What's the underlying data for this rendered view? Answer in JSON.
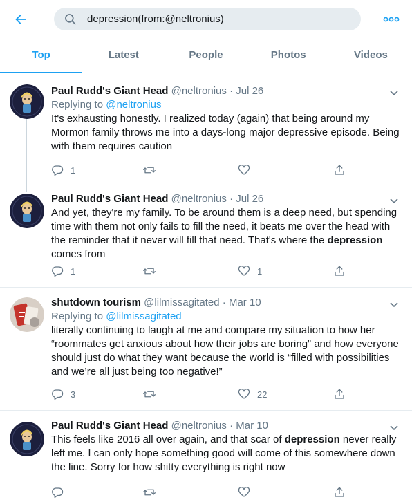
{
  "search": {
    "query": "depression(from:@neltronius)"
  },
  "tabs": [
    {
      "label": "Top"
    },
    {
      "label": "Latest"
    },
    {
      "label": "People"
    },
    {
      "label": "Photos"
    },
    {
      "label": "Videos"
    }
  ],
  "colors": {
    "accent": "#1da1f2",
    "muted": "#657786",
    "text": "#14171a",
    "divider": "#e6ecf0"
  },
  "tweets": [
    {
      "name": "Paul Rudd's Giant Head",
      "handle": "@neltronius",
      "dot": "·",
      "date": "Jul 26",
      "reply_prefix": "Replying to",
      "reply_to": "@neltronius",
      "text_before": "It's exhausting honestly. I realized today (again) that being around my Mormon family throws me into a days-long major depressive episode. Being with them requires caution",
      "bold": "",
      "text_after": "",
      "replies": "1",
      "retweets": "",
      "likes": ""
    },
    {
      "name": "Paul Rudd's Giant Head",
      "handle": "@neltronius",
      "dot": "·",
      "date": "Jul 26",
      "text_before": "And yet, they're my family. To be around them is a deep need, but spending time with them not only fails to fill the need, it beats me over the head with the reminder that it never will fill that need. That's where the ",
      "bold": "depression",
      "text_after": " comes from",
      "replies": "1",
      "retweets": "",
      "likes": "1"
    },
    {
      "name": "shutdown tourism",
      "handle": "@lilmissagitated",
      "dot": "·",
      "date": "Mar 10",
      "reply_prefix": "Replying to",
      "reply_to": "@lilmissagitated",
      "text_before": "literally continuing to laugh at me and compare my situation to how her “roommates get anxious about how their jobs are boring” and how everyone should just do what they want because the world is “filled with possibilities and we’re all just being too negative!”",
      "bold": "",
      "text_after": "",
      "replies": "3",
      "retweets": "",
      "likes": "22"
    },
    {
      "name": "Paul Rudd's Giant Head",
      "handle": "@neltronius",
      "dot": "·",
      "date": "Mar 10",
      "text_before": "This feels like 2016 all over again, and that scar of ",
      "bold": "depression",
      "text_after": " never really left me. I can only hope something good will come of this somewhere down the line. Sorry for how shitty everything is right now",
      "replies": "",
      "retweets": "",
      "likes": ""
    }
  ]
}
